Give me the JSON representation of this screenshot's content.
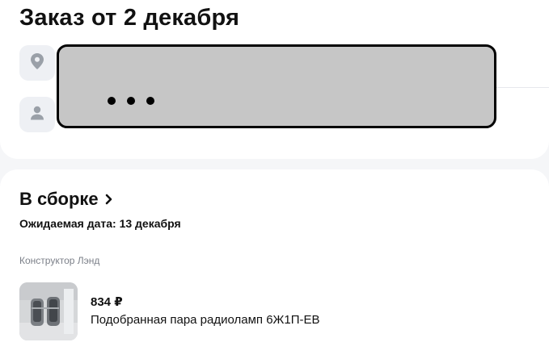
{
  "order": {
    "title": "Заказ от 2 декабря"
  },
  "icons": {
    "address": "location-pin-icon",
    "recipient": "person-icon"
  },
  "shipment": {
    "status": "В сборке",
    "expected_date": "Ожидаемая дата: 13 декабря",
    "seller": "Конструктор Лэнд",
    "item": {
      "price": "834 ₽",
      "name": "Подобранная пара радиоламп 6Ж1П-ЕВ"
    }
  },
  "colors": {
    "background": "#f5f6f8",
    "card": "#ffffff",
    "icon_bg": "#eef0f4",
    "icon_fg": "#9aa0a8",
    "muted_text": "#7c8089",
    "redaction_fill": "#c6c6c6"
  }
}
